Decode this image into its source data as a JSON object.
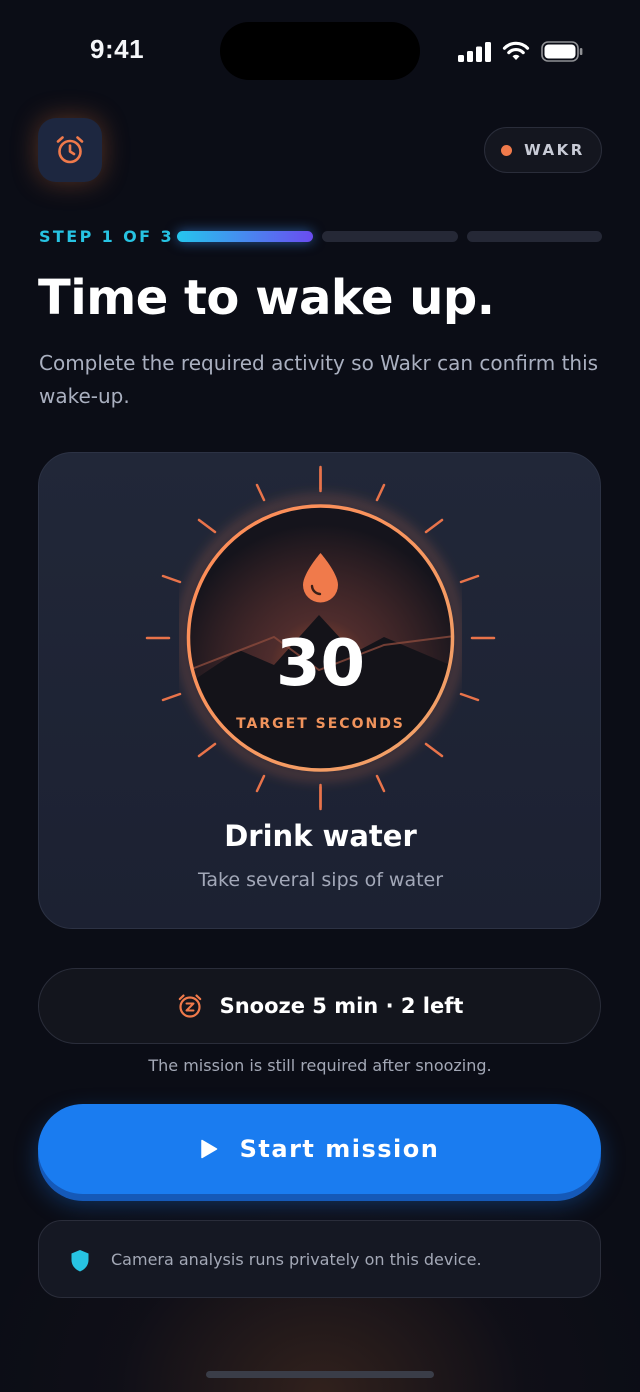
{
  "status_bar": {
    "time": "9:41"
  },
  "header": {
    "brand": "WAKR",
    "app_icon": "alarm-clock-icon"
  },
  "progress": {
    "label": "STEP 1 OF 3",
    "current_step": 1,
    "total_steps": 3
  },
  "heading": {
    "title": "Time to wake up.",
    "subtitle": "Complete the required activity so Wakr can confirm this wake-up."
  },
  "mission": {
    "icon": "water-drop-icon",
    "target_value": "30",
    "target_label": "TARGET SECONDS",
    "name": "Drink water",
    "description": "Take several sips of water"
  },
  "snooze": {
    "icon": "snooze-alarm-icon",
    "label": "Snooze 5 min · 2 left",
    "note": "The mission is still required after snoozing."
  },
  "start_button": {
    "icon": "play-icon",
    "label": "Start mission"
  },
  "privacy": {
    "icon": "shield-icon",
    "text": "Camera analysis runs privately on this device."
  },
  "colors": {
    "background": "#0b0d16",
    "accent_orange": "#f07a4b",
    "accent_cyan": "#27c3e2",
    "primary_blue": "#1a7cf0"
  }
}
